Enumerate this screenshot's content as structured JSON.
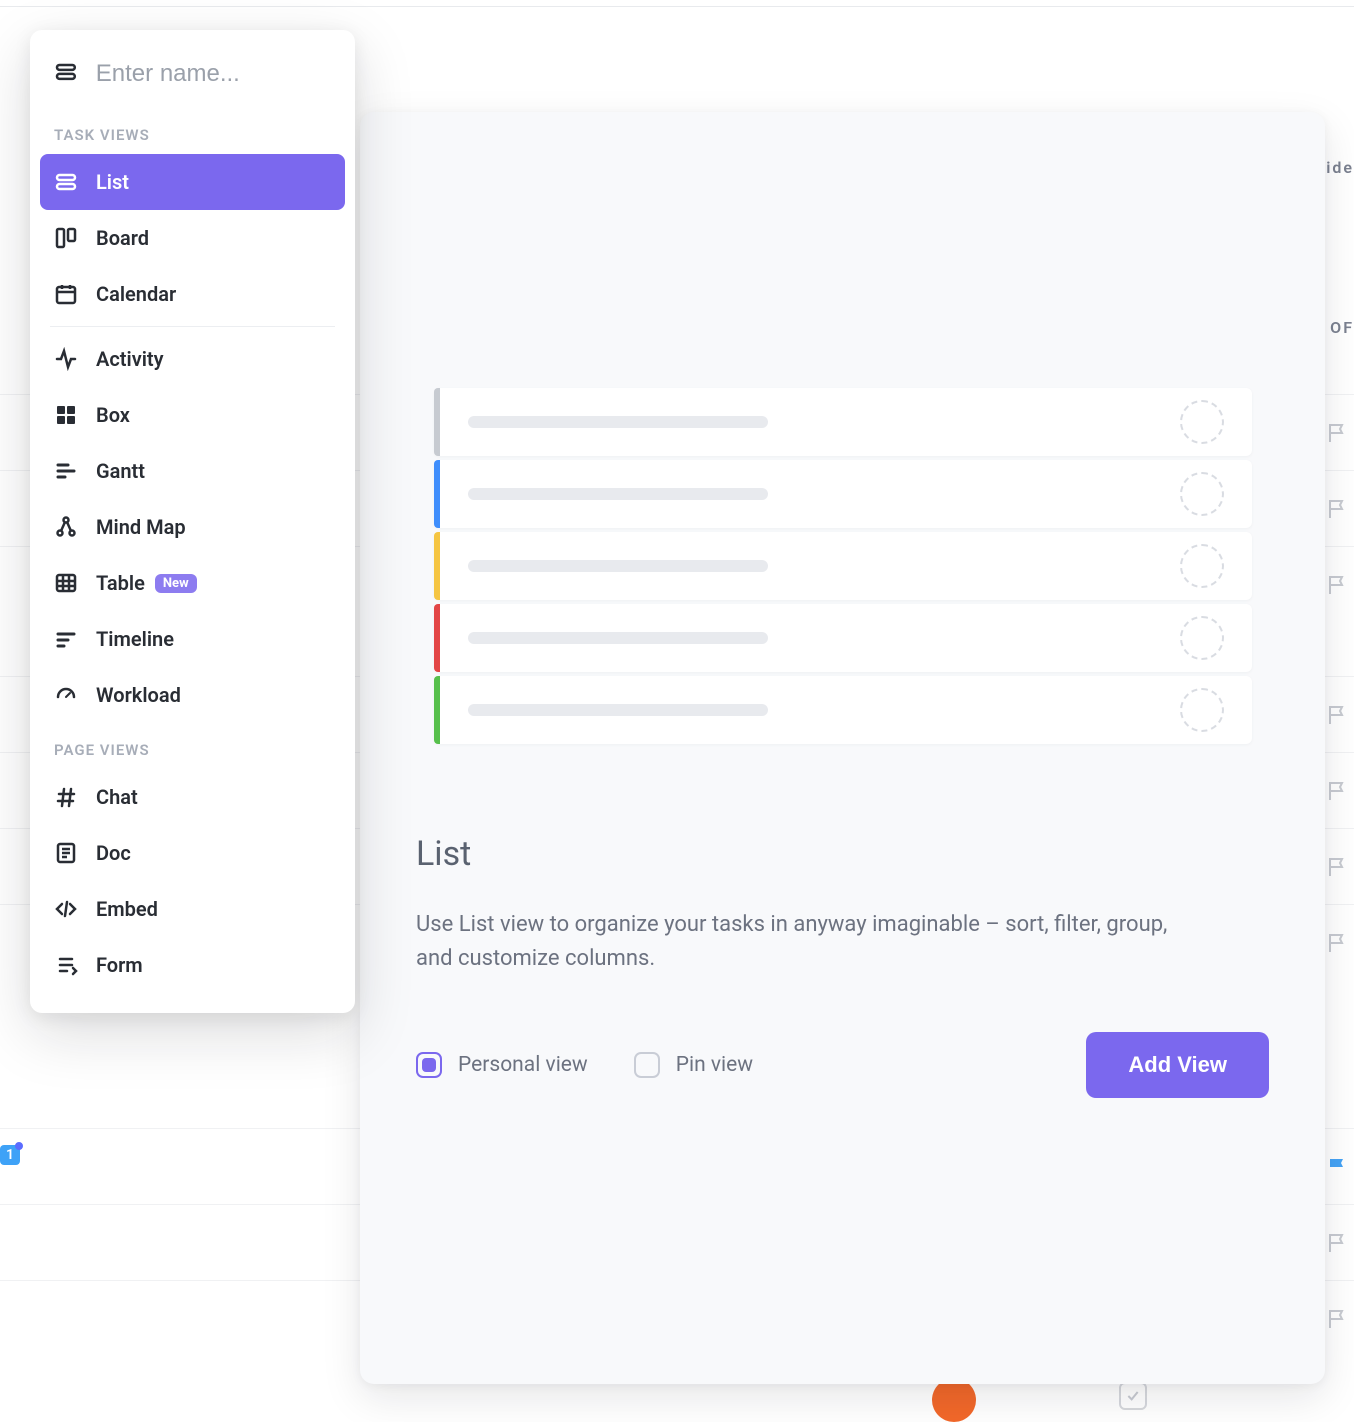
{
  "popover": {
    "name_placeholder": "Enter name...",
    "section_task_views": "TASK VIEWS",
    "section_page_views": "PAGE VIEWS",
    "new_badge": "New",
    "task_views": [
      {
        "id": "list",
        "label": "List",
        "selected": true
      },
      {
        "id": "board",
        "label": "Board"
      },
      {
        "id": "calendar",
        "label": "Calendar"
      },
      {
        "id": "activity",
        "label": "Activity"
      },
      {
        "id": "box",
        "label": "Box"
      },
      {
        "id": "gantt",
        "label": "Gantt"
      },
      {
        "id": "mindmap",
        "label": "Mind Map"
      },
      {
        "id": "table",
        "label": "Table",
        "badge": "new"
      },
      {
        "id": "timeline",
        "label": "Timeline"
      },
      {
        "id": "workload",
        "label": "Workload"
      }
    ],
    "page_views": [
      {
        "id": "chat",
        "label": "Chat"
      },
      {
        "id": "doc",
        "label": "Doc"
      },
      {
        "id": "embed",
        "label": "Embed"
      },
      {
        "id": "form",
        "label": "Form"
      }
    ]
  },
  "panel": {
    "title": "List",
    "description": "Use List view to organize your tasks in anyway imaginable – sort, filter, group, and customize columns.",
    "personal_view_label": "Personal view",
    "pin_view_label": "Pin view",
    "personal_view_checked": true,
    "pin_view_checked": false,
    "add_view_button": "Add View",
    "preview_stripes": [
      "#c7cbd1",
      "#3f8efc",
      "#f5c542",
      "#e34646",
      "#57c04c"
    ]
  },
  "background": {
    "hide_text": "ide",
    "op_text": "OF",
    "badge_count": "1"
  }
}
